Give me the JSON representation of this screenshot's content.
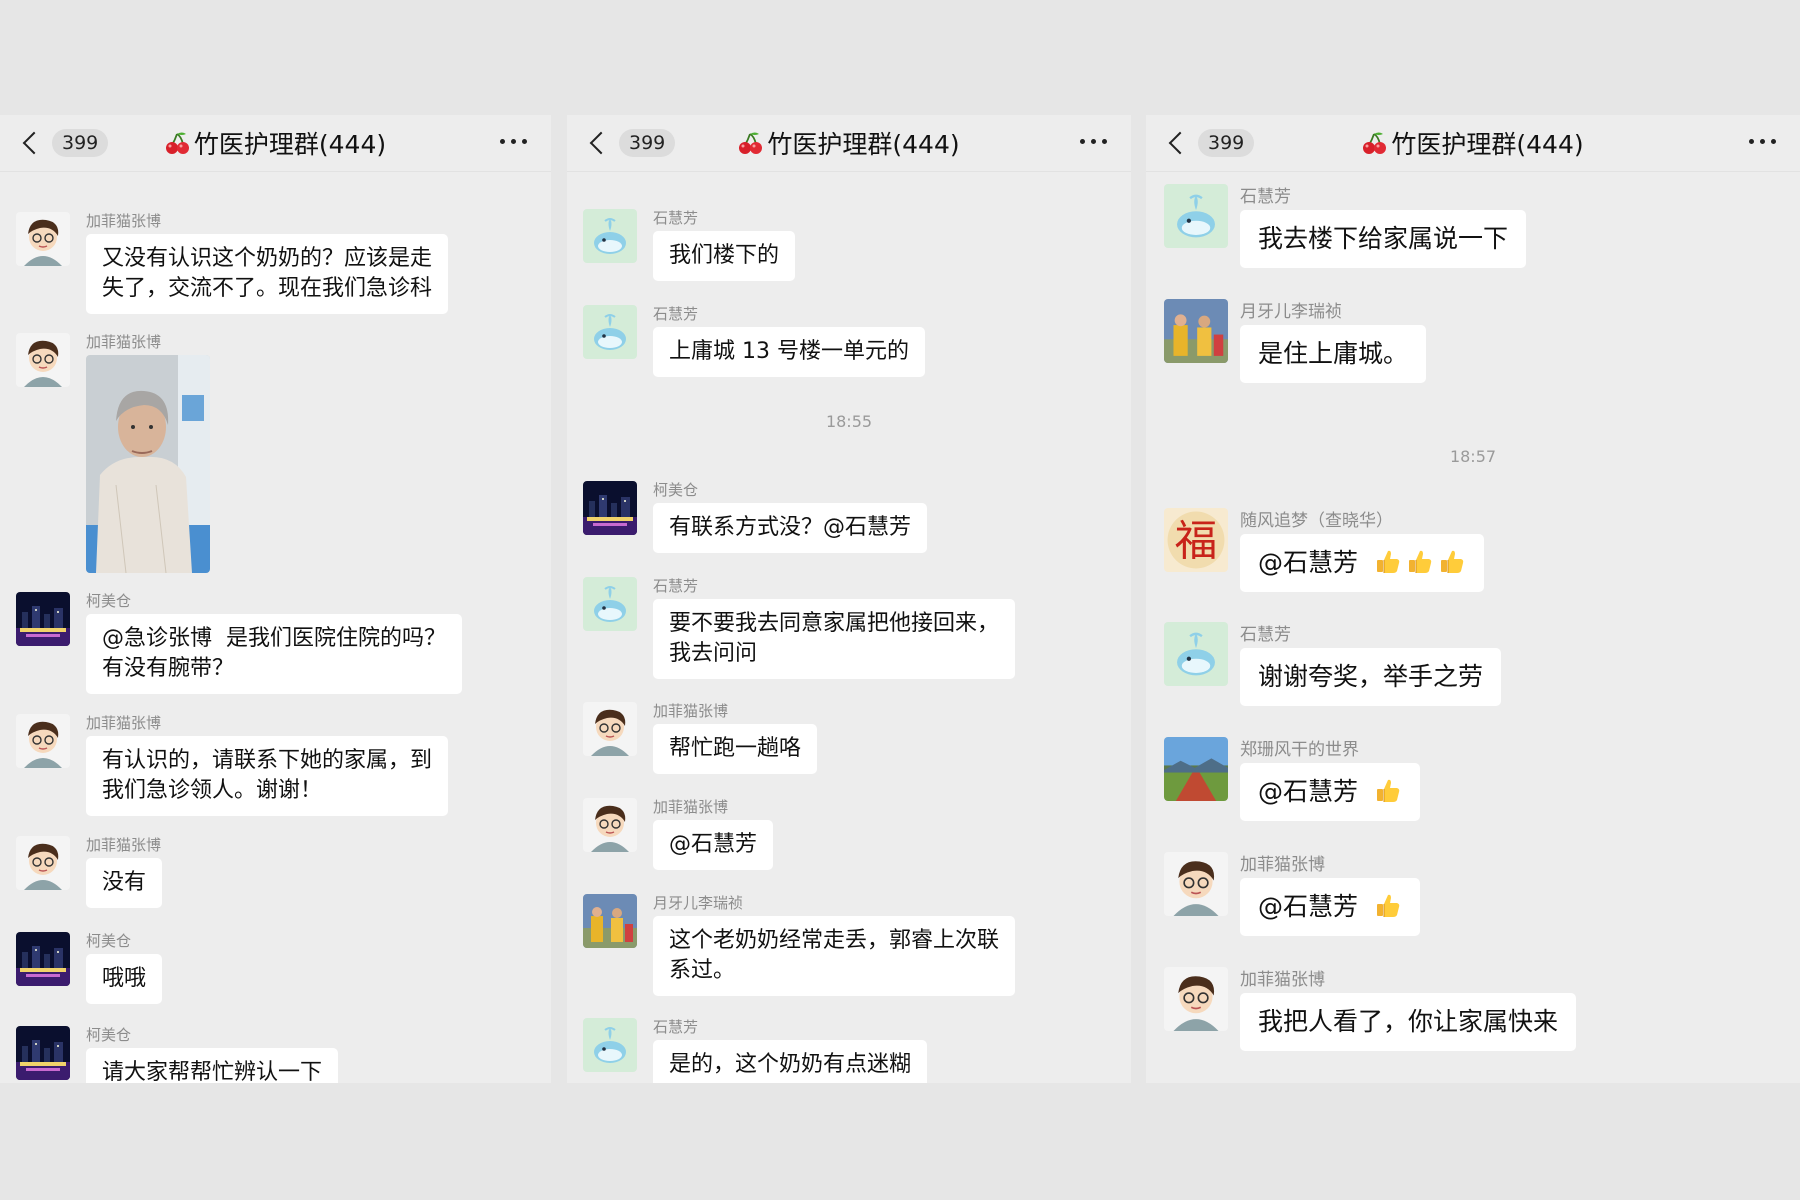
{
  "panels": [
    {
      "back_count": "399",
      "title": "竹医护理群(444)",
      "messages": [
        {
          "sender": "加菲猫张博",
          "text": "又没有认识这个奶奶的？应该是走\n失了，交流不了。现在我们急诊科"
        },
        {
          "sender": "加菲猫张博",
          "image": "elderly-woman-photo"
        },
        {
          "sender": "柯美仓",
          "text": "@急诊张博  是我们医院住院的吗？\n有没有腕带？"
        },
        {
          "sender": "加菲猫张博",
          "text": "有认识的，请联系下她的家属，到\n我们急诊领人。谢谢！"
        },
        {
          "sender": "加菲猫张博",
          "text": "没有"
        },
        {
          "sender": "柯美仓",
          "text": "哦哦"
        },
        {
          "sender": "柯美仓",
          "text": "请大家帮帮忙辨认一下"
        }
      ]
    },
    {
      "back_count": "399",
      "title": "竹医护理群(444)",
      "messages": [
        {
          "sender": "石慧芳",
          "text": "我们楼下的"
        },
        {
          "sender": "石慧芳",
          "text": "上庸城 13 号楼一单元的"
        },
        {
          "time": "18:55"
        },
        {
          "sender": "柯美仓",
          "text": "有联系方式没？@石慧芳"
        },
        {
          "sender": "石慧芳",
          "text": "要不要我去同意家属把他接回来，\n我去问问"
        },
        {
          "sender": "加菲猫张博",
          "text": "帮忙跑一趟咯"
        },
        {
          "sender": "加菲猫张博",
          "text": "@石慧芳"
        },
        {
          "sender": "月牙儿李瑞祯",
          "text": "这个老奶奶经常走丢，郭睿上次联\n系过。"
        },
        {
          "sender": "石慧芳",
          "text": "是的，这个奶奶有点迷糊"
        }
      ]
    },
    {
      "back_count": "399",
      "title": "竹医护理群(444)",
      "messages": [
        {
          "sender": "石慧芳",
          "text": "我去楼下给家属说一下"
        },
        {
          "sender": "月牙儿李瑞祯",
          "text": "是住上庸城。"
        },
        {
          "time": "18:57"
        },
        {
          "sender": "随风追梦（查晓华）",
          "text": "@石慧芳",
          "thumbs": 3
        },
        {
          "sender": "石慧芳",
          "text": "谢谢夸奖，举手之劳"
        },
        {
          "sender": "郑珊风干的世界",
          "text": "@石慧芳",
          "thumbs": 1
        },
        {
          "sender": "加菲猫张博",
          "text": "@石慧芳",
          "thumbs": 1
        },
        {
          "sender": "加菲猫张博",
          "text": "我把人看了，你让家属快来"
        }
      ]
    }
  ],
  "avatars": {
    "加菲猫张博": "cartoon-boy-avatar",
    "柯美仓": "night-city-avatar",
    "石慧芳": "whale-avatar",
    "月牙儿李瑞祯": "people-photo-avatar",
    "随风追梦（查晓华）": "fu-character-avatar",
    "郑珊风干的世界": "landscape-avatar"
  },
  "colors": {
    "background": "#e6e6e6",
    "panel": "#ededed",
    "bubble": "#ffffff",
    "name": "#8c8c8c"
  }
}
